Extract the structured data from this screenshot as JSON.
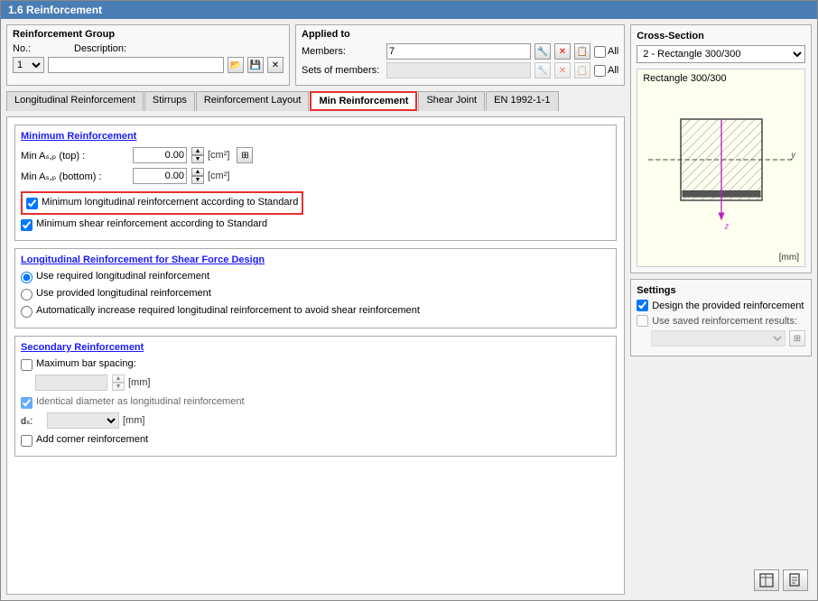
{
  "window": {
    "title": "1.6 Reinforcement"
  },
  "reinforcement_group": {
    "label": "Reinforcement Group",
    "no_label": "No.:",
    "no_value": "1",
    "desc_label": "Description:"
  },
  "applied_to": {
    "label": "Applied to",
    "members_label": "Members:",
    "members_value": "7",
    "sets_label": "Sets of members:",
    "all_label": "All",
    "all_label2": "All"
  },
  "tabs": {
    "longitudinal": "Longitudinal Reinforcement",
    "stirrups": "Stirrups",
    "layout": "Reinforcement Layout",
    "min_reinforcement": "Min Reinforcement",
    "shear_joint": "Shear Joint",
    "en": "EN 1992-1-1"
  },
  "min_reinforcement_section": {
    "title": "Minimum Reinforcement",
    "min_as_z_top_label": "Min Aₛ,ₚ (top) :",
    "min_as_z_top_value": "0.00",
    "min_as_z_bottom_label": "Min Aₛ,ₚ (bottom) :",
    "min_as_z_bottom_value": "0.00",
    "unit": "[cm²]",
    "checkbox1_label": "Minimum longitudinal reinforcement according to Standard",
    "checkbox1_checked": true,
    "checkbox2_label": "Minimum shear reinforcement according to Standard",
    "checkbox2_checked": true
  },
  "longitudinal_shear": {
    "title": "Longitudinal Reinforcement for Shear Force Design",
    "radio1": "Use required longitudinal reinforcement",
    "radio2": "Use provided longitudinal reinforcement",
    "radio3": "Automatically increase required longitudinal reinforcement to avoid shear reinforcement",
    "selected": "radio1"
  },
  "secondary": {
    "title": "Secondary Reinforcement",
    "max_bar_spacing_label": "Maximum bar spacing:",
    "max_bar_checked": false,
    "unit_mm": "[mm]",
    "identical_diameter_label": "Identical diameter as longitudinal reinforcement",
    "identical_checked": true,
    "ds_label": "dₛ:",
    "add_corner_label": "Add corner reinforcement",
    "add_corner_checked": false
  },
  "cross_section": {
    "title": "Cross-Section",
    "dropdown_value": "2 - Rectangle 300/300",
    "diagram_label": "Rectangle 300/300",
    "mm_label": "[mm]"
  },
  "settings": {
    "title": "Settings",
    "design_label": "Design the provided reinforcement",
    "design_checked": true,
    "saved_label": "Use saved reinforcement results:",
    "saved_checked": false
  },
  "bottom_buttons": {
    "btn1": "📊",
    "btn2": "📋"
  }
}
